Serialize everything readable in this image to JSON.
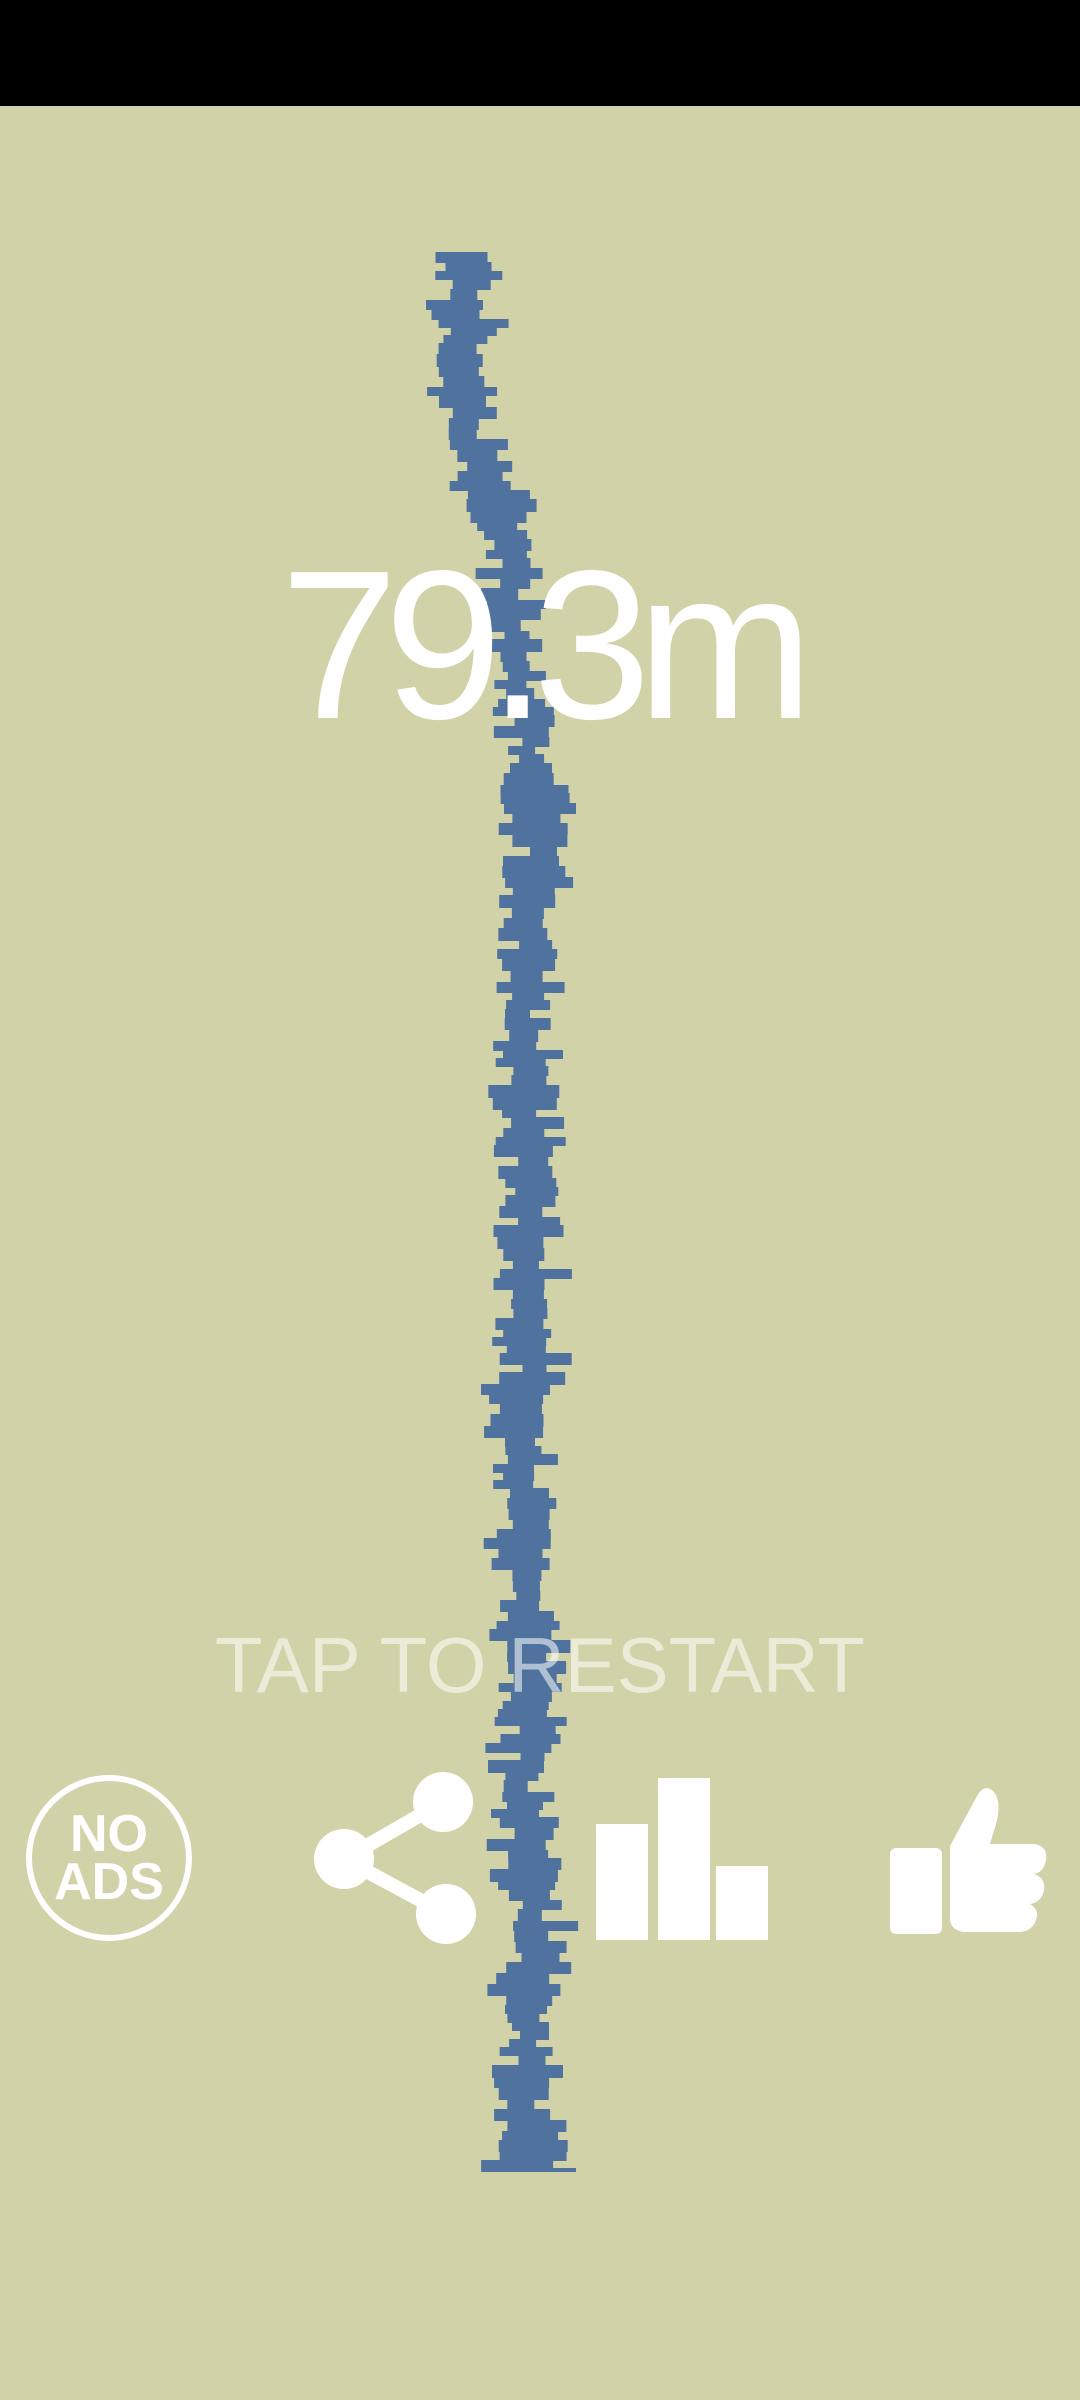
{
  "score": {
    "value": "79.3m"
  },
  "prompt": {
    "restart": "TAP TO RESTART"
  },
  "buttons": {
    "no_ads": {
      "line1": "NO",
      "line2": "ADS",
      "icon": "no-ads-icon"
    },
    "share": {
      "icon": "share-icon"
    },
    "leaderboard": {
      "icon": "bar-chart-icon"
    },
    "like": {
      "icon": "thumbs-up-icon"
    }
  },
  "colors": {
    "background": "#d2d2a9",
    "status_bar": "#000000",
    "tower": "#4f739e",
    "text": "#ffffff"
  }
}
